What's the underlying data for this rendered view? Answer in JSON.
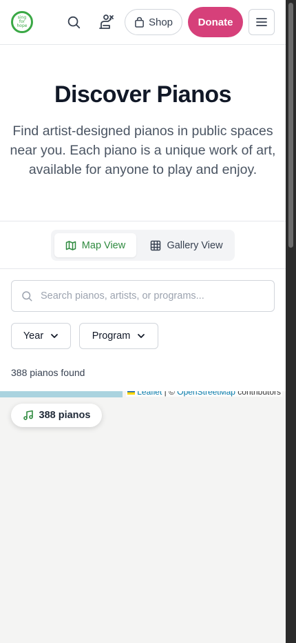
{
  "header": {
    "logo_line1": "sing",
    "logo_line2": "for",
    "logo_line3": "hope",
    "search_icon": "search-icon",
    "pianist_icon": "pianist-icon",
    "shop_label": "Shop",
    "donate_label": "Donate",
    "menu_icon": "hamburger-menu-icon"
  },
  "hero": {
    "title": "Discover Pianos",
    "subtitle": "Find artist-designed pianos in public spaces near you. Each piano is a unique work of art, available for anyone to play and enjoy."
  },
  "view_toggle": {
    "map_label": "Map View",
    "gallery_label": "Gallery View",
    "active": "Map View"
  },
  "search": {
    "placeholder": "Search pianos, artists, or programs...",
    "value": ""
  },
  "filters": {
    "year_label": "Year",
    "program_label": "Program"
  },
  "results": {
    "count_text": "388 pianos found"
  },
  "map": {
    "attribution_leaflet": "Leaflet",
    "attribution_sep": " | © ",
    "attribution_osm": "OpenStreetMap",
    "attribution_tail": " contributors",
    "pill_label": "388 pianos"
  },
  "colors": {
    "brand_green": "#2f8a3f",
    "donate_pink": "#d6407a"
  }
}
